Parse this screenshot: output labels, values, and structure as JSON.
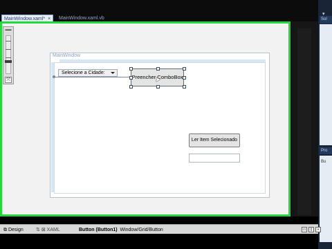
{
  "tabs": [
    {
      "label": "MainWindow.xaml*",
      "close": "×"
    },
    {
      "label": "MainWindow.xaml.vb"
    }
  ],
  "zoom": {
    "fit_symbol": "⤧"
  },
  "wpf_window": {
    "title": "MainWindow",
    "combo_text": "Selecione a Cidade:",
    "fill_button": "Preencher ComboBox",
    "read_button": "Ler Item Selecionado",
    "output_value": ""
  },
  "right_panel": {
    "header1": "Sol",
    "header2": "Pro",
    "body2_label": "Bu"
  },
  "statusbar": {
    "design_tab": "Design",
    "xaml_tab": "XAML",
    "breadcrumb_item": "Button (Button1)",
    "breadcrumb_path": "Window/Grid/Button"
  },
  "colors": {
    "highlight": "#22d83a",
    "dark_bg": "#000000"
  }
}
